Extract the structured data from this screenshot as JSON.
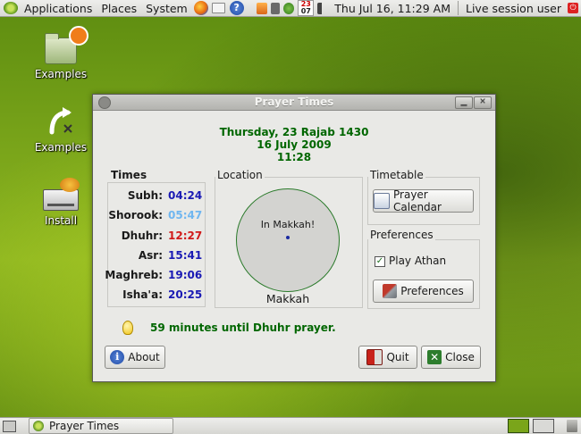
{
  "top_panel": {
    "menus": [
      "Applications",
      "Places",
      "System"
    ],
    "launchers": [
      "firefox-icon",
      "mail-icon",
      "help-icon"
    ],
    "tray": {
      "calendar_badge_day": "23",
      "calendar_badge_month": "07",
      "clock": "Thu Jul 16, 11:29 AM",
      "session": "Live session user"
    }
  },
  "desktop": {
    "icons": [
      {
        "label": "Examples",
        "icon": "folder-icon"
      },
      {
        "label": "Examples",
        "icon": "symlink-arrow-icon"
      },
      {
        "label": "Install",
        "icon": "install-drive-icon"
      }
    ]
  },
  "window": {
    "title": "Prayer Times",
    "date": {
      "hijri": "Thursday, 23 Rajab 1430",
      "gregorian": "16 July 2009",
      "time": "11:28"
    },
    "times": {
      "title": "Times",
      "rows": [
        {
          "label": "Subh:",
          "value": "04:24",
          "color": "#1a1ab4"
        },
        {
          "label": "Shorook:",
          "value": "05:47",
          "color": "#6fb6f0"
        },
        {
          "label": "Dhuhr:",
          "value": "12:27",
          "color": "#d11a1a"
        },
        {
          "label": "Asr:",
          "value": "15:41",
          "color": "#1a1ab4"
        },
        {
          "label": "Maghreb:",
          "value": "19:06",
          "color": "#1a1ab4"
        },
        {
          "label": "Isha'a:",
          "value": "20:25",
          "color": "#1a1ab4"
        }
      ]
    },
    "location": {
      "title": "Location",
      "map_text": "In Makkah!",
      "city": "Makkah"
    },
    "timetable": {
      "title": "Timetable",
      "button": "Prayer Calendar"
    },
    "preferences": {
      "title": "Preferences",
      "play_athan_label": "Play Athan",
      "play_athan_checked": true,
      "button": "Preferences"
    },
    "next_prayer": "59 minutes until Dhuhr prayer.",
    "buttons": {
      "about": "About",
      "quit": "Quit",
      "close": "Close"
    }
  },
  "bottom_panel": {
    "task": "Prayer Times"
  },
  "colors": {
    "accent_green": "#006600",
    "desktop_green": "#7aa51a"
  }
}
